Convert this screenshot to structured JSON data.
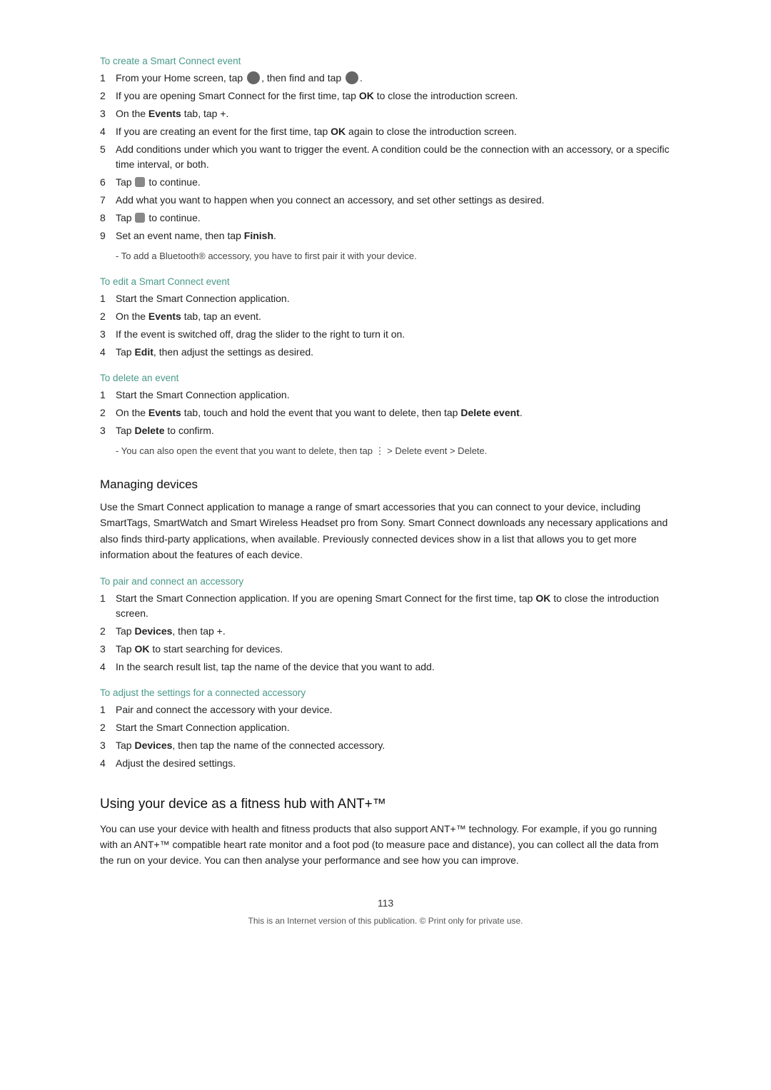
{
  "page": {
    "number": "113",
    "footer": "This is an Internet version of this publication. © Print only for private use."
  },
  "sections": {
    "create_smart_connect": {
      "heading": "To create a Smart Connect event",
      "steps": [
        {
          "num": "1",
          "text": "From your Home screen, tap [grid-icon], then find and tap [settings-icon]."
        },
        {
          "num": "2",
          "text": "If you are opening Smart Connect for the first time, tap OK to close the introduction screen."
        },
        {
          "num": "3",
          "text": "On the Events tab, tap +."
        },
        {
          "num": "4",
          "text": "If you are creating an event for the first time, tap OK again to close the introduction screen."
        },
        {
          "num": "5",
          "text": "Add conditions under which you want to trigger the event. A condition could be the connection with an accessory, or a specific time interval, or both."
        },
        {
          "num": "6",
          "text": "Tap [next-icon] to continue."
        },
        {
          "num": "7",
          "text": "Add what you want to happen when you connect an accessory, and set other settings as desired."
        },
        {
          "num": "8",
          "text": "Tap [next-icon] to continue."
        },
        {
          "num": "9",
          "text": "Set an event name, then tap Finish."
        }
      ],
      "note": "To add a Bluetooth® accessory, you have to first pair it with your device."
    },
    "edit_smart_connect": {
      "heading": "To edit a Smart Connect event",
      "steps": [
        {
          "num": "1",
          "text": "Start the Smart Connection application."
        },
        {
          "num": "2",
          "text": "On the Events tab, tap an event."
        },
        {
          "num": "3",
          "text": "If the event is switched off, drag the slider to the right to turn it on."
        },
        {
          "num": "4",
          "text": "Tap Edit, then adjust the settings as desired."
        }
      ]
    },
    "delete_event": {
      "heading": "To delete an event",
      "steps": [
        {
          "num": "1",
          "text": "Start the Smart Connection application."
        },
        {
          "num": "2",
          "text": "On the Events tab, touch and hold the event that you want to delete, then tap Delete event."
        },
        {
          "num": "3",
          "text": "Tap Delete to confirm."
        }
      ],
      "note": "You can also open the event that you want to delete, then tap ⋮ > Delete event > Delete."
    },
    "managing_devices": {
      "title": "Managing devices",
      "body": "Use the Smart Connect application to manage a range of smart accessories that you can connect to your device, including SmartTags, SmartWatch and Smart Wireless Headset pro from Sony. Smart Connect downloads any necessary applications and also finds third-party applications, when available. Previously connected devices show in a list that allows you to get more information about the features of each device."
    },
    "pair_connect": {
      "heading": "To pair and connect an accessory",
      "steps": [
        {
          "num": "1",
          "text": "Start the Smart Connection application. If you are opening Smart Connect for the first time, tap OK to close the introduction screen."
        },
        {
          "num": "2",
          "text": "Tap Devices, then tap +."
        },
        {
          "num": "3",
          "text": "Tap OK to start searching for devices."
        },
        {
          "num": "4",
          "text": "In the search result list, tap the name of the device that you want to add."
        }
      ]
    },
    "adjust_settings": {
      "heading": "To adjust the settings for a connected accessory",
      "steps": [
        {
          "num": "1",
          "text": "Pair and connect the accessory with your device."
        },
        {
          "num": "2",
          "text": "Start the Smart Connection application."
        },
        {
          "num": "3",
          "text": "Tap Devices, then tap the name of the connected accessory."
        },
        {
          "num": "4",
          "text": "Adjust the desired settings."
        }
      ]
    },
    "fitness_hub": {
      "title": "Using your device as a fitness hub with ANT+™",
      "body": "You can use your device with health and fitness products that also support ANT+™ technology. For example, if you go running with an ANT+™ compatible heart rate monitor and a foot pod (to measure pace and distance), you can collect all the data from the run on your device. You can then analyse your performance and see how you can improve."
    }
  }
}
